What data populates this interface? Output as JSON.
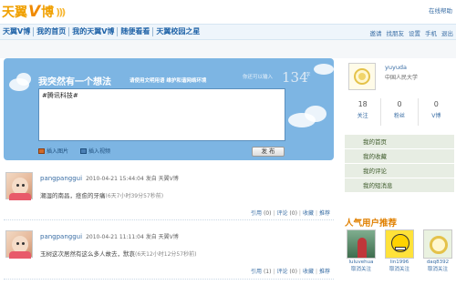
{
  "logo": {
    "text_left": "天翼",
    "text_v": "V",
    "text_right": "博"
  },
  "help": "在线帮助",
  "nav": {
    "items": [
      "天翼V博",
      "我的首页",
      "我的天翼V博",
      "随便看看",
      "天翼校园之星"
    ],
    "right": [
      "邀请",
      "找朋友",
      "设置",
      "手机",
      "退出"
    ]
  },
  "compose": {
    "title": "我突然有一个想法",
    "subtitle": "请使用文明用语 维护和谐网络环境",
    "hint": "你还可以输入",
    "count": "134",
    "unit": "字",
    "text": "#腾讯科技#",
    "insert_image": "插入图片",
    "insert_video": "插入视频",
    "send": "发 布"
  },
  "posts": [
    {
      "author": "pangpanggui",
      "meta": "2010-04-21 15:44:04 发自 天翼V博",
      "body": "潮湿的南昌，痉愈的牙痛",
      "time": "(6天7小时39分57秒前)",
      "actions": [
        "引用",
        "(0)",
        "评论",
        "(0)",
        "收藏",
        "推荐"
      ]
    },
    {
      "author": "pangpanggui",
      "meta": "2010-04-21 11:11:04 发自 天翼V博",
      "body": "玉树这次居然有这么多人故去，默哀",
      "time": "(6天12小时12分57秒前)",
      "actions": [
        "引用",
        "(1)",
        "评论",
        "(0)",
        "收藏",
        "推荐"
      ]
    }
  ],
  "profile": {
    "name": "yuyuda",
    "school": "中国人民大学",
    "stats": [
      {
        "num": "18",
        "label": "关注"
      },
      {
        "num": "0",
        "label": "粉丝"
      },
      {
        "num": "0",
        "label": "V博"
      }
    ]
  },
  "menu": [
    "我的首页",
    "我的收藏",
    "我的评论",
    "我的短消息"
  ],
  "recommend": {
    "title": "人气用户推荐",
    "users": [
      {
        "name": "luluvehua",
        "follow": "取消关注"
      },
      {
        "name": "lin1996",
        "follow": "取消关注"
      },
      {
        "name": "daq8392",
        "follow": "取消关注"
      }
    ]
  }
}
